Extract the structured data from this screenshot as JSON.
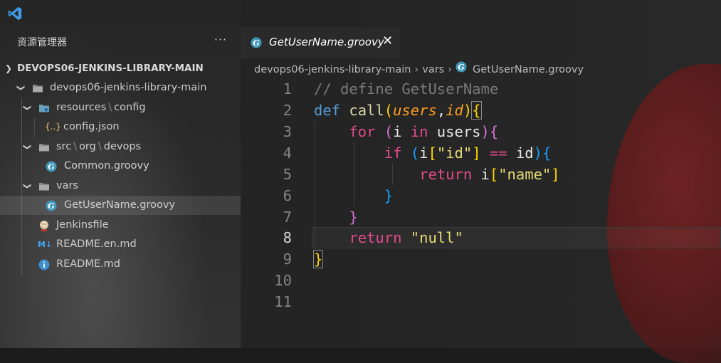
{
  "sidebar": {
    "explorer_title": "资源管理器",
    "more_label": "···",
    "root_folder": "DEVOPS06-JENKINS-LIBRARY-MAIN",
    "tree": [
      {
        "label": "devops06-jenkins-library-main",
        "icon": "folder-icon"
      },
      {
        "label": "resources",
        "sep": "\\",
        "label2": "config",
        "icon": "folder-config-icon"
      },
      {
        "label": "config.json",
        "icon": "json-icon"
      },
      {
        "label": "src",
        "sep1": "\\",
        "mid": "org",
        "sep2": "\\",
        "label2": "devops",
        "icon": "folder-icon"
      },
      {
        "label": "Common.groovy",
        "icon": "groovy-icon"
      },
      {
        "label": "vars",
        "icon": "folder-icon"
      },
      {
        "label": "GetUserName.groovy",
        "icon": "groovy-icon"
      },
      {
        "label": "Jenkinsfile",
        "icon": "jenkins-icon"
      },
      {
        "label": "README.en.md",
        "icon": "markdown-icon"
      },
      {
        "label": "README.md",
        "icon": "info-icon"
      }
    ]
  },
  "tab": {
    "label": "GetUserName.groovy",
    "close": "✕"
  },
  "breadcrumb": [
    "devops06-jenkins-library-main",
    "vars",
    "GetUserName.groovy"
  ],
  "editor": {
    "line_numbers": [
      "1",
      "2",
      "3",
      "4",
      "5",
      "6",
      "7",
      "8",
      "9",
      "10",
      "11"
    ],
    "active_line": 8
  },
  "colors": {
    "accent": "#3794ff",
    "keyword_blue": "#569cd6",
    "keyword_pink": "#e24a8d",
    "string": "#e6db74",
    "parameter": "#ff9d1e",
    "function": "#dcdcaa",
    "comment": "#7a7a7a"
  }
}
